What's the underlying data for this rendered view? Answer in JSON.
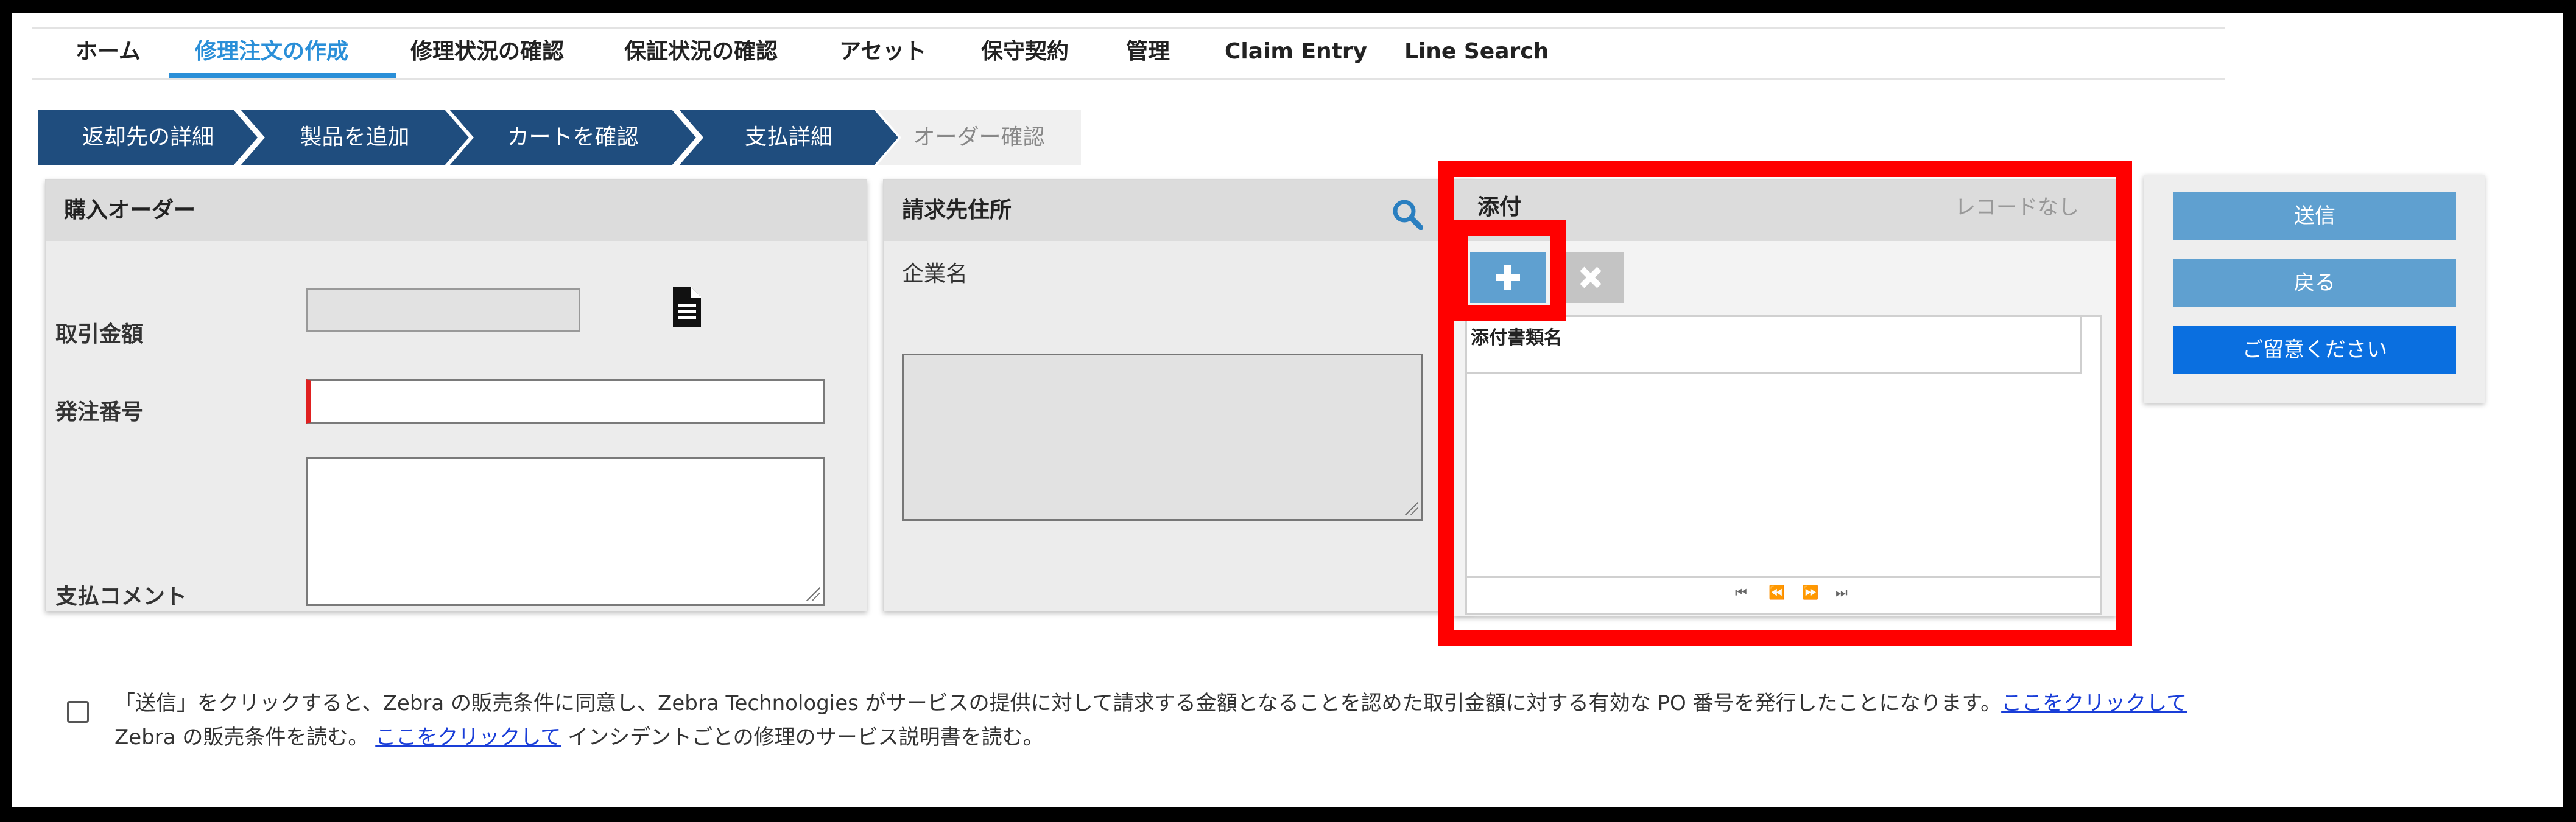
{
  "nav": {
    "items": [
      {
        "label": "ホーム",
        "active": false
      },
      {
        "label": "修理注文の作成",
        "active": true
      },
      {
        "label": "修理状況の確認",
        "active": false
      },
      {
        "label": "保証状況の確認",
        "active": false
      },
      {
        "label": "アセット",
        "active": false
      },
      {
        "label": "保守契約",
        "active": false
      },
      {
        "label": "管理",
        "active": false
      },
      {
        "label": "Claim Entry",
        "active": false
      },
      {
        "label": "Line Search",
        "active": false
      }
    ]
  },
  "steps": [
    {
      "label": "返却先の詳細",
      "state": "done"
    },
    {
      "label": "製品を追加",
      "state": "done"
    },
    {
      "label": "カートを確認",
      "state": "done"
    },
    {
      "label": "支払詳細",
      "state": "current"
    },
    {
      "label": "オーダー確認",
      "state": "pending"
    }
  ],
  "purchase_order": {
    "title": "購入オーダー",
    "amount_label": "取引金額",
    "amount_value": "",
    "po_number_label": "発注番号",
    "po_number_value": "",
    "payment_comment_label": "支払コメント",
    "payment_comment_value": ""
  },
  "billing": {
    "title": "請求先住所",
    "company_label": "企業名",
    "address_value": ""
  },
  "attachments": {
    "title": "添付",
    "record_status": "レコードなし",
    "column_header": "添付書類名",
    "pager": {
      "first": "⏮",
      "prev": "⏪",
      "next": "⏩",
      "last": "⏭"
    }
  },
  "actions": {
    "submit_label": "送信",
    "back_label": "戻る",
    "notice_label": "ご留意ください"
  },
  "terms": {
    "text_before": "「送信」をクリックすると、Zebra の販売条件に同意し、Zebra Technologies がサービスの提供に対して請求する金額となることを認めた取引金額に対する有効な PO 番号を発行したことになります。",
    "link1": "ここをクリックして",
    "text_middle": " Zebra の販売条件を読む。 ",
    "link2": "ここをクリックして",
    "text_after": " インシデントごとの修理のサービス説明書を読む。"
  },
  "colors": {
    "brand_blue": "#1f4d7e",
    "active_tab": "#2a8fd8",
    "button_light_blue": "#5fa0d0",
    "button_primary": "#0a6fe0",
    "highlight_red": "#ff0000"
  }
}
